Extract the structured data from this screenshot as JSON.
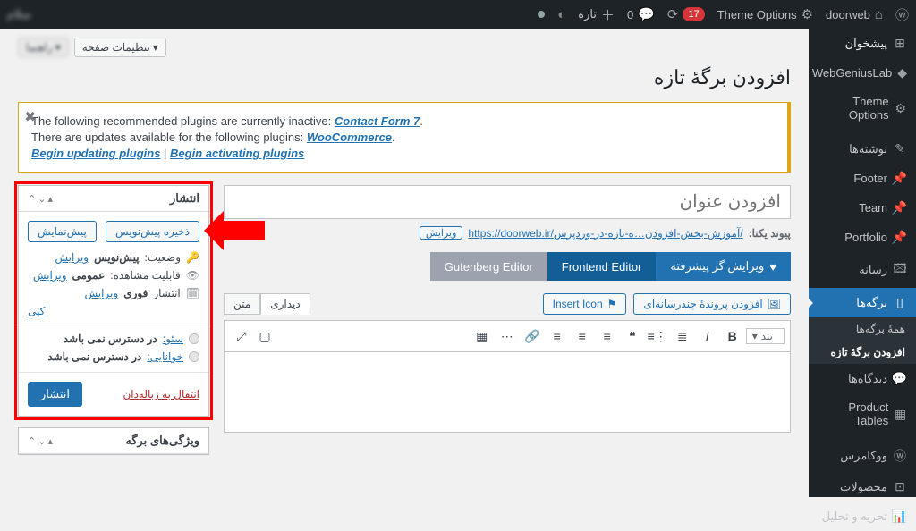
{
  "adminbar": {
    "site": "doorweb",
    "theme_options": "Theme Options",
    "updates": "17",
    "comments": "0",
    "new": "تازه",
    "howdy": "سلام"
  },
  "sidebar": {
    "dashboard": "پیشخوان",
    "webgenius": "WebGeniusLab",
    "theme_options": "Theme Options",
    "posts": "نوشته‌ها",
    "footer": "Footer",
    "team": "Team",
    "portfolio": "Portfolio",
    "media": "رسانه",
    "pages": "برگه‌ها",
    "pages_all": "همهٔ برگه‌ها",
    "pages_new": "افزودن برگهٔ تازه",
    "comments": "دیدگاه‌ها",
    "product_tables": "Product Tables",
    "woocommerce": "ووکامرس",
    "products": "محصولات",
    "analytics": "تحریه و تحلیل"
  },
  "screen": {
    "options": "تنظیمات صفحه",
    "help": "راهنما"
  },
  "title": "افزودن برگهٔ تازه",
  "notice": {
    "l1a": "The following recommended plugins are currently inactive: ",
    "l1b": "Contact Form 7",
    "l2a": "There are updates available for the following plugins: ",
    "l2b": "WooCommerce",
    "l3a": "Begin updating plugins",
    "l3b": "Begin activating plugins"
  },
  "editor": {
    "title_ph": "افزودن عنوان",
    "perm_label": "پیوند یکتا:",
    "perm_url": "https://doorweb.ir/آموزش-بخش-افزودن…ه-تازه-در-وردپرس/",
    "perm_edit": "ویرایش",
    "tab_adv": "ویرایش گر پیشرفته",
    "tab_fe": "Frontend Editor",
    "tab_gut": "Gutenberg Editor",
    "add_media": "افزودن پروندهٔ چندرسانه‌ای",
    "insert_icon": "Insert Icon",
    "tab_visual": "دیداری",
    "tab_text": "متن",
    "para": "بند"
  },
  "publish": {
    "title": "انتشار",
    "save_draft": "ذخیره پیش‌نویس",
    "preview": "پیش‌نمایش",
    "status_l": "وضعیت:",
    "status_v": "پیش‌نویس",
    "vis_l": "قابلیت مشاهده:",
    "vis_v": "عمومی",
    "pub_l": "انتشار",
    "pub_v": "فوری",
    "edit": "ویرایش",
    "copy": "کپی",
    "seo_l": "سئو:",
    "seo_v": "در دسترس نمی باشد",
    "read_l": "خوانایی:",
    "read_v": "در دسترس نمی باشد",
    "trash": "انتقال به زباله‌دان",
    "publish_btn": "انتشار"
  },
  "attrs": {
    "title": "ویژگی‌های برگه"
  }
}
